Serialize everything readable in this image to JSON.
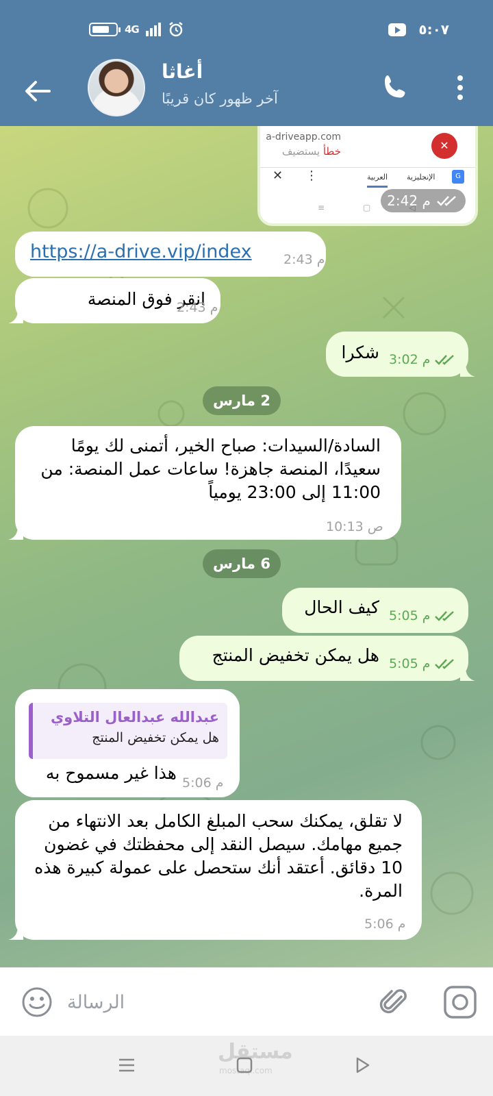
{
  "status_bar": {
    "network": "4G",
    "time": "٥:٠٧"
  },
  "header": {
    "name": "أغاثا",
    "status": "آخر ظهور كان قريبًا"
  },
  "forwarded_screenshot": {
    "url": "a-driveapp.com",
    "error_word": "خطأ",
    "error_rest": "يستضيف",
    "lang_target": "العربية",
    "lang_source": "الإنجليزية",
    "time": "2:42 م"
  },
  "messages": [
    {
      "text": "https://a-drive.vip/index",
      "time": "2:43 م"
    },
    {
      "text": "انقر فوق المنصة",
      "time": "2:43 م"
    },
    {
      "text": "شكرا",
      "time": "3:02 م"
    },
    {
      "text": "السادة/السيدات: صباح الخير، أتمنى لك يومًا سعيدًا، المنصة جاهزة! ساعات عمل المنصة: من 11:00 إلى 23:00 يومياً",
      "time": "10:13 ص"
    },
    {
      "text": "كيف الحال",
      "time": "5:05 م"
    },
    {
      "text": "هل يمكن تخفيض المنتج",
      "time": "5:05 م"
    },
    {
      "text": "هذا غير مسموح به",
      "time": "5:06 م",
      "reply_to": {
        "name": "عبدالله عبدالعال التلاوي",
        "text": "هل يمكن تخفيض المنتج"
      }
    },
    {
      "text": "لا تقلق، يمكنك سحب المبلغ الكامل بعد الانتهاء من جميع مهامك. سيصل النقد إلى محفظتك في غضون 10 دقائق. أعتقد أنك ستحصل على عمولة كبيرة هذه المرة.",
      "time": "5:06 م"
    }
  ],
  "date_chips": [
    "2 مارس",
    "6 مارس"
  ],
  "composer": {
    "placeholder": "الرسالة"
  },
  "watermark": {
    "text": "مستقل",
    "sub": "mostaql.com"
  },
  "colors": {
    "header": "#537ea6",
    "incoming": "#ffffff",
    "outgoing": "#effdde",
    "tick": "#5ca853",
    "reply_accent": "#9b60c9"
  }
}
